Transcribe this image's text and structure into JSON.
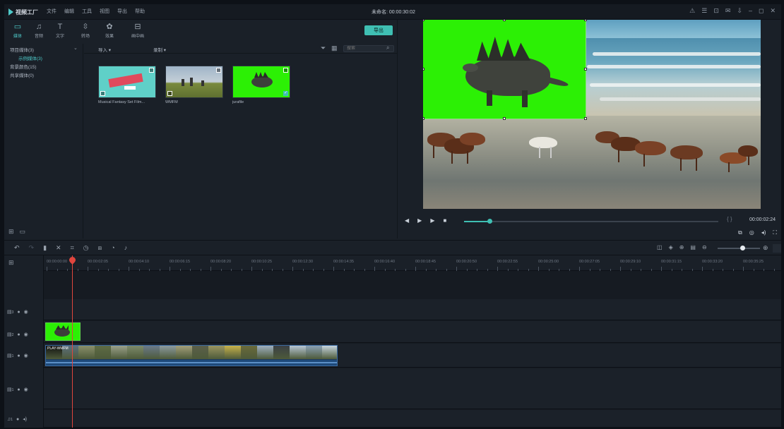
{
  "app": {
    "name": "视频工厂",
    "menu": [
      "文件",
      "编辑",
      "工具",
      "视图",
      "导出",
      "帮助"
    ],
    "title_time": "未命名: 00:00:30:02",
    "window_controls": [
      "⚠",
      "☰",
      "⊡",
      "✉",
      "⇩",
      "–",
      "◻",
      "✕"
    ]
  },
  "toolbar": {
    "items": [
      {
        "icon": "folder-icon",
        "glyph": "▭",
        "label": "媒体"
      },
      {
        "icon": "music-icon",
        "glyph": "♫",
        "label": "音频"
      },
      {
        "icon": "text-icon",
        "glyph": "T",
        "label": "文字"
      },
      {
        "icon": "transition-icon",
        "glyph": "⇳",
        "label": "转场"
      },
      {
        "icon": "effects-icon",
        "glyph": "✿",
        "label": "效果"
      },
      {
        "icon": "split-screen-icon",
        "glyph": "⊟",
        "label": "画中画"
      }
    ],
    "export_label": "导出"
  },
  "library": {
    "items": [
      {
        "label": "项目媒体(3)",
        "sub": false
      },
      {
        "label": "示例媒体(3)",
        "sub": true
      },
      {
        "label": "背景颜色(15)",
        "sub": false
      },
      {
        "label": "共享媒体(0)",
        "sub": false
      }
    ]
  },
  "media": {
    "import_label": "导入",
    "record_label": "录制",
    "search_placeholder": "搜索",
    "clips": [
      {
        "name": "Musical Fantasy Set Film...",
        "kind": "pink"
      },
      {
        "name": "WMFM",
        "kind": "field"
      },
      {
        "name": "jurafile",
        "kind": "green"
      }
    ]
  },
  "preview": {
    "time": "00:00:02:24",
    "progress": 0.1,
    "brackets": "{ }"
  },
  "timeline": {
    "ruler": [
      "00:00:00:00",
      "00:00:02:05",
      "00:00:04:10",
      "00:00:06:15",
      "00:00:08:20",
      "00:00:10:25",
      "00:00:12:30",
      "00:00:14:35",
      "00:00:16:40",
      "00:00:18:45",
      "00:00:20:50",
      "00:00:22:55",
      "00:00:25:00",
      "00:00:27:05",
      "00:00:29:10",
      "00:00:31:15",
      "00:00:33:20",
      "00:00:35:25"
    ],
    "track_labels": [
      "3",
      "2",
      "1",
      "1",
      "1"
    ],
    "video_clip_label": "PLAY-WMFM"
  }
}
